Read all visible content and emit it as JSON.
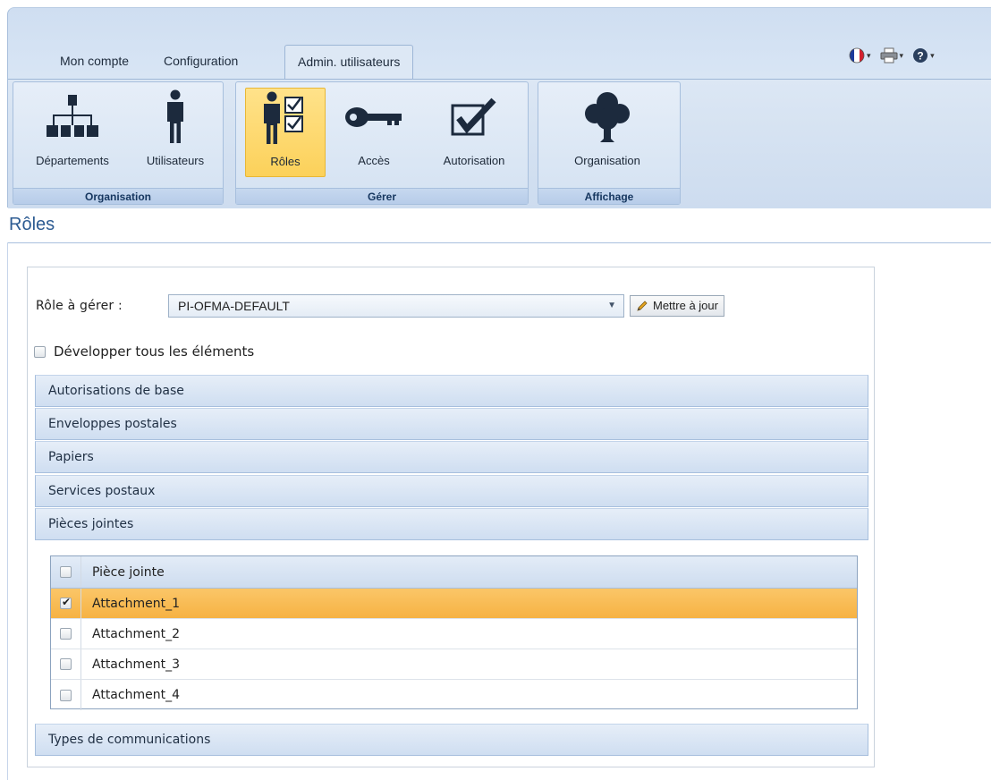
{
  "tabs": [
    {
      "label": "Mon compte"
    },
    {
      "label": "Configuration"
    },
    {
      "label": "Admin. utilisateurs"
    }
  ],
  "toolbar_icons": [
    "france-flag-icon",
    "printer-icon",
    "help-icon"
  ],
  "ribbon": {
    "groups": [
      {
        "label": "Organisation",
        "buttons": [
          {
            "label": "Départements",
            "icon": "org-chart-icon"
          },
          {
            "label": "Utilisateurs",
            "icon": "user-icon"
          }
        ]
      },
      {
        "label": "Gérer",
        "buttons": [
          {
            "label": "Rôles",
            "icon": "user-checklist-icon",
            "selected": true
          },
          {
            "label": "Accès",
            "icon": "key-icon"
          },
          {
            "label": "Autorisation",
            "icon": "checkmark-box-icon"
          }
        ]
      },
      {
        "label": "Affichage",
        "buttons": [
          {
            "label": "Organisation",
            "icon": "tree-icon"
          }
        ]
      }
    ]
  },
  "page": {
    "title": "Rôles"
  },
  "role_form": {
    "label": "Rôle à gérer :",
    "selected_role": "PI-OFMA-DEFAULT",
    "update_label": "Mettre à jour",
    "expand_all_label": "Développer tous les éléments",
    "expand_all_checked": false
  },
  "accordion": {
    "sections": [
      {
        "label": "Autorisations de base"
      },
      {
        "label": "Enveloppes postales"
      },
      {
        "label": "Papiers"
      },
      {
        "label": "Services postaux"
      },
      {
        "label": "Pièces jointes",
        "expanded": true
      },
      {
        "label": "Types de communications"
      }
    ]
  },
  "attachments_grid": {
    "header": "Pièce jointe",
    "rows": [
      {
        "name": "Attachment_1",
        "checked": true,
        "selected": true
      },
      {
        "name": "Attachment_2",
        "checked": false
      },
      {
        "name": "Attachment_3",
        "checked": false
      },
      {
        "name": "Attachment_4",
        "checked": false
      }
    ]
  },
  "colors": {
    "ribbon_bg": "#cfdef1",
    "title_blue": "#2c5b92",
    "selected_button": "#fcd15a",
    "selected_row": "#f6b243"
  }
}
